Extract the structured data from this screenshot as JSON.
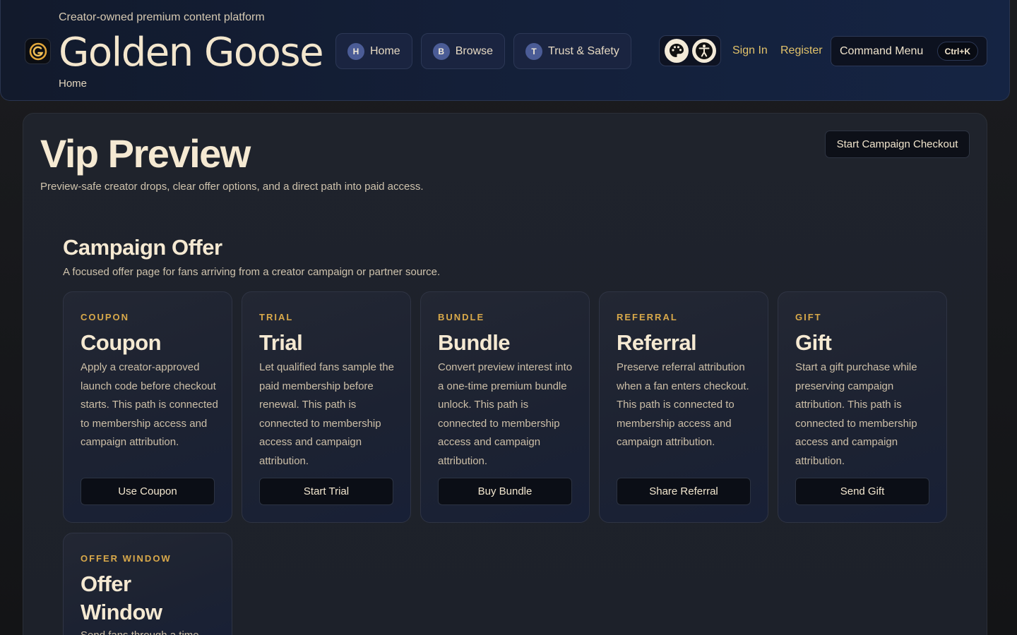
{
  "header": {
    "tagline": "Creator-owned premium content platform",
    "brand": "Golden Goose",
    "breadcrumb": "Home",
    "nav": [
      {
        "letter": "H",
        "label": "Home"
      },
      {
        "letter": "B",
        "label": "Browse"
      },
      {
        "letter": "T",
        "label": "Trust & Safety"
      }
    ],
    "icons": [
      "palette-icon",
      "accessibility-icon"
    ],
    "sign_in": "Sign In",
    "register": "Register",
    "command_menu": "Command Menu",
    "command_shortcut": "Ctrl+K"
  },
  "page": {
    "title": "Vip Preview",
    "subtitle": "Preview-safe creator drops, clear offer options, and a direct path into paid access.",
    "checkout_button": "Start Campaign Checkout"
  },
  "section": {
    "title": "Campaign Offer",
    "subtitle": "A focused offer page for fans arriving from a creator campaign or partner source."
  },
  "cards": [
    {
      "kicker": "COUPON",
      "title": "Coupon",
      "body": "Apply a creator-approved launch code before checkout starts. This path is connected to membership access and campaign attribution.",
      "button": "Use Coupon"
    },
    {
      "kicker": "TRIAL",
      "title": "Trial",
      "body": "Let qualified fans sample the paid membership before renewal. This path is connected to membership access and campaign attribution.",
      "button": "Start Trial"
    },
    {
      "kicker": "BUNDLE",
      "title": "Bundle",
      "body": "Convert preview interest into a one-time premium bundle unlock. This path is connected to membership access and campaign attribution.",
      "button": "Buy Bundle"
    },
    {
      "kicker": "REFERRAL",
      "title": "Referral",
      "body": "Preserve referral attribution when a fan enters checkout. This path is connected to membership access and campaign attribution.",
      "button": "Share Referral"
    },
    {
      "kicker": "GIFT",
      "title": "Gift",
      "body": "Start a gift purchase while preserving campaign attribution. This path is connected to membership access and campaign attribution.",
      "button": "Send Gift"
    },
    {
      "kicker": "OFFER WINDOW",
      "title": "Offer Window",
      "body": "Send fans through a time-"
    }
  ],
  "colors": {
    "accent": "#d9a94a",
    "link": "#e2c26a",
    "text": "#f5e9d2",
    "header_bg": "#14203a",
    "panel_bg": "#1f232c"
  }
}
